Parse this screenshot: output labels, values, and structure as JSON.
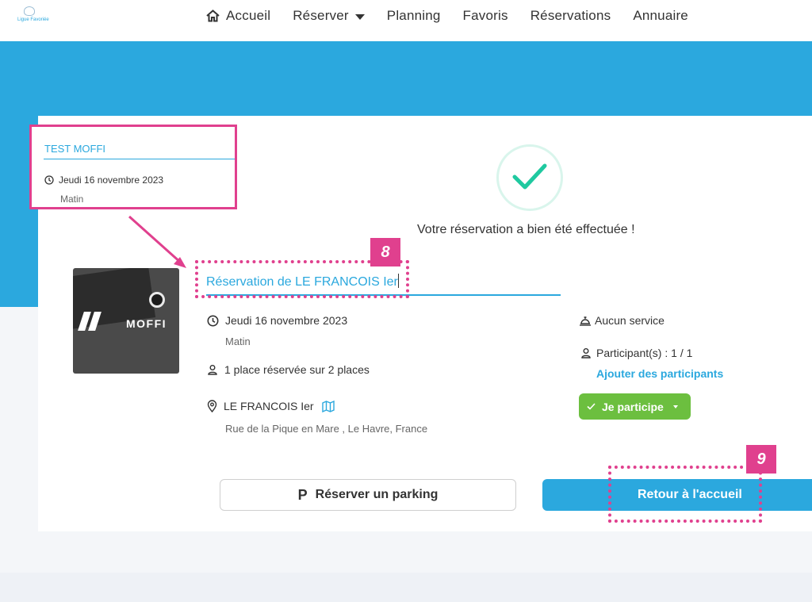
{
  "nav": {
    "logo_text": "Ligue Favoriée",
    "items": [
      {
        "label": "Accueil"
      },
      {
        "label": "Réserver"
      },
      {
        "label": "Planning"
      },
      {
        "label": "Favoris"
      },
      {
        "label": "Réservations"
      },
      {
        "label": "Annuaire"
      }
    ]
  },
  "thumbnail": {
    "brand": "MOFFI"
  },
  "success_message": "Votre réservation a bien été effectuée !",
  "reservation": {
    "title": "Réservation de LE FRANCOIS Ier",
    "date": "Jeudi 16 novembre 2023",
    "period": "Matin",
    "places": "1 place réservée sur 2 places",
    "location_name": "LE FRANCOIS Ier",
    "address": "Rue de la Pique en Mare , Le Havre, France",
    "service": "Aucun service",
    "participants": "Participant(s) : 1 / 1",
    "add_participants": "Ajouter des participants",
    "participate": "Je participe"
  },
  "buttons": {
    "parking_letter": "P",
    "parking": "Réserver un parking",
    "home": "Retour à l'accueil"
  },
  "callout": {
    "title": "TEST MOFFI",
    "date": "Jeudi 16 novembre 2023",
    "period": "Matin"
  },
  "steps": {
    "step8": "8",
    "step9": "9"
  },
  "colors": {
    "accent": "#2ba8de",
    "annotation": "#e0408e",
    "success": "#6cbf3f",
    "check": "#1fc9a0"
  }
}
